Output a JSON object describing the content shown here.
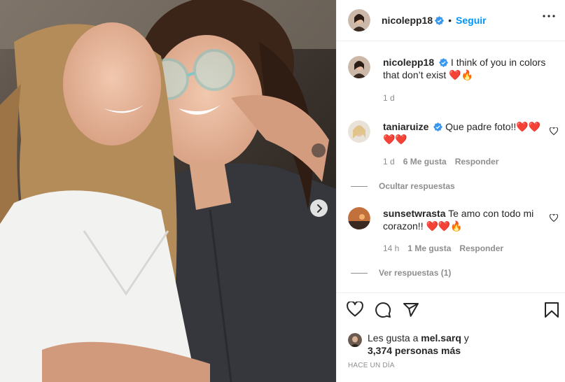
{
  "post": {
    "author": "nicolepp18",
    "follow_label": "Seguir",
    "icons": {
      "verified": "verified-badge-icon",
      "more": "more-options-icon",
      "next": "chevron-right-icon"
    }
  },
  "caption": {
    "username": "nicolepp18",
    "text": "I think of you in colors that don’t exist ❤️🔥",
    "time": "1 d"
  },
  "comments": [
    {
      "username": "taniaruize",
      "text": "Que padre foto!!❤️❤️❤️❤️",
      "time": "1 d",
      "likes": "6 Me gusta",
      "reply_label": "Responder",
      "replies_label": "Ocultar respuestas"
    },
    {
      "username": "sunsetwrasta",
      "text": "Te amo con todo mi corazon!! ❤️❤️🔥",
      "time": "14 h",
      "likes": "1 Me gusta",
      "reply_label": "Responder",
      "replies_label": "Ver respuestas (1)"
    }
  ],
  "likes": {
    "prefix": "Les gusta a",
    "user": "mel.sarq",
    "joiner": "y",
    "others": "3,374 personas más"
  },
  "posted_ago": "HACE UN DÍA",
  "colors": {
    "accent": "#0095f6",
    "verified": "#3897f0",
    "muted": "#8e8e8e",
    "text": "#262626"
  }
}
